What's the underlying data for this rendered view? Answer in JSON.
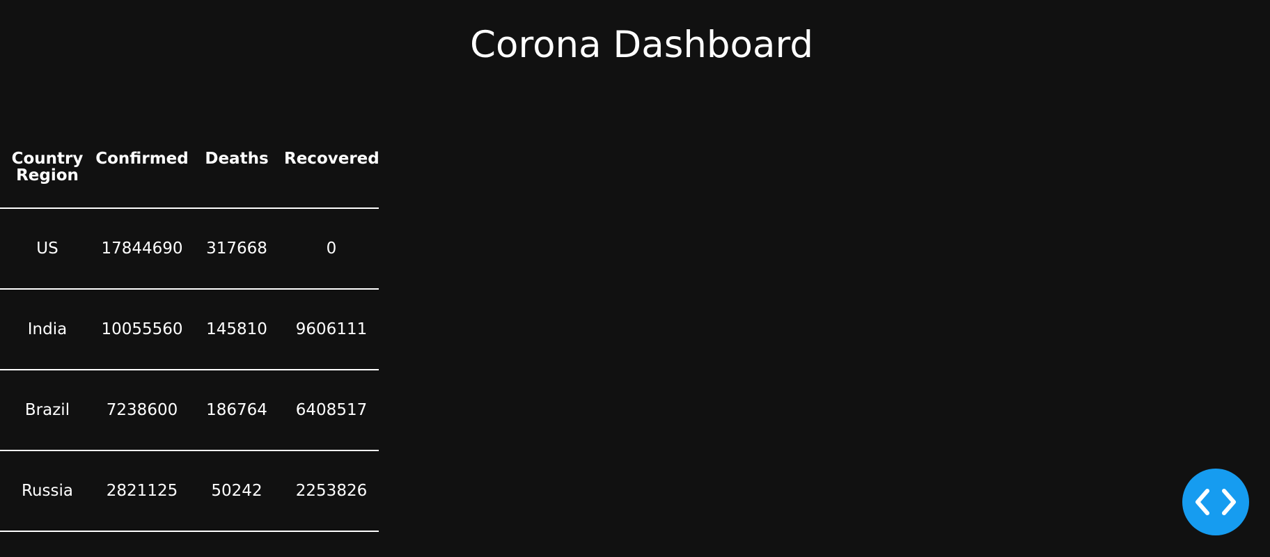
{
  "page": {
    "title": "Corona Dashboard"
  },
  "table": {
    "headers": [
      "Country Region",
      "Confirmed",
      "Deaths",
      "Recovered"
    ],
    "rows": [
      {
        "country": "US",
        "confirmed": "17844690",
        "deaths": "317668",
        "recovered": "0"
      },
      {
        "country": "India",
        "confirmed": "10055560",
        "deaths": "145810",
        "recovered": "9606111"
      },
      {
        "country": "Brazil",
        "confirmed": "7238600",
        "deaths": "186764",
        "recovered": "6408517"
      },
      {
        "country": "Russia",
        "confirmed": "2821125",
        "deaths": "50242",
        "recovered": "2253826"
      }
    ]
  },
  "fab": {
    "icon": "code-icon",
    "color": "#169cf0"
  },
  "colors": {
    "background": "#111111",
    "text": "#ffffff"
  }
}
